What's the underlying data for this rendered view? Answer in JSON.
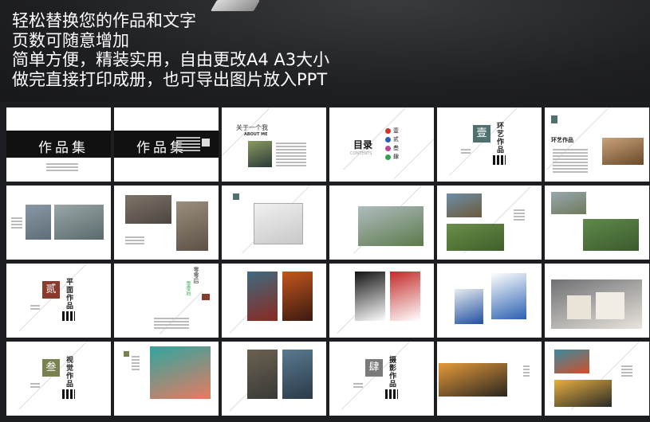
{
  "headline": [
    "轻松替换您的作品和文字",
    "页数可随意增加",
    "简单方便，精装实用，自由更改A4 A3大小",
    "做完直接打印成册，也可导出图片放入PPT"
  ],
  "pages": [
    {
      "kind": "cover",
      "title": "作品集"
    },
    {
      "kind": "cover2",
      "title": "作品集"
    },
    {
      "kind": "about",
      "title": "关于一个我",
      "subtitle": "ABOUT ME"
    },
    {
      "kind": "toc",
      "title": "目录",
      "subtitle": "CONTENTS",
      "items": [
        {
          "label": "壹",
          "color": "#d8322c"
        },
        {
          "label": "贰",
          "color": "#2a5fb8"
        },
        {
          "label": "叁",
          "color": "#b8479a"
        },
        {
          "label": "肆",
          "color": "#2ea54a"
        }
      ]
    },
    {
      "kind": "section",
      "num": "壹",
      "title": "环艺作品",
      "color": "#4f7270"
    },
    {
      "kind": "textimg",
      "title": "环艺作品",
      "badge_color": "#4f7270",
      "images": [
        "#c9a27a"
      ]
    },
    {
      "kind": "images",
      "images": [
        [
          "#8a98a6",
          "#5f6d78"
        ],
        [
          "#9aa6a8",
          "#5a6a6c"
        ]
      ],
      "layout": "two-right"
    },
    {
      "kind": "images",
      "images": [
        [
          "#7d7469",
          "#4d463e"
        ],
        [
          "#9b8e7d",
          "#5c5146"
        ]
      ],
      "layout": "two-left"
    },
    {
      "kind": "images",
      "images": [
        [
          "#f0f0f0",
          "#c8c8c8"
        ]
      ],
      "layout": "plan"
    },
    {
      "kind": "images",
      "images": [
        [
          "#b0bcc0",
          "#5c7a4a"
        ]
      ],
      "layout": "one"
    },
    {
      "kind": "images",
      "images": [
        [
          "#6b8ea8",
          "#6d5a3a"
        ],
        [
          "#6a8f4a",
          "#3f5f2a"
        ]
      ],
      "layout": "stack"
    },
    {
      "kind": "images",
      "images": [
        [
          "#98a8b0",
          "#6e7a5a"
        ],
        [
          "#5f8a4a",
          "#3c5a2e"
        ]
      ],
      "layout": "stack2"
    },
    {
      "kind": "section",
      "num": "贰",
      "title": "平面作品",
      "color": "#8a3b2e"
    },
    {
      "kind": "text",
      "title": "零零后",
      "color": "#3aa84a"
    },
    {
      "kind": "images",
      "images": [
        [
          "#3e6a80",
          "#8a2a20"
        ],
        [
          "#c4561e",
          "#3a1a10"
        ]
      ],
      "layout": "posters"
    },
    {
      "kind": "images",
      "images": [
        [
          "#111111",
          "#ffffff"
        ],
        [
          "#c42a2a",
          "#ffffff"
        ]
      ],
      "layout": "posters"
    },
    {
      "kind": "images",
      "images": [
        [
          "#e8ecef",
          "#1f4fa0"
        ],
        [
          "#ffffff",
          "#2a60b0"
        ]
      ],
      "layout": "brochure"
    },
    {
      "kind": "images",
      "images": [
        [
          "#6f7074",
          "#e8e4dc"
        ]
      ],
      "layout": "boxes"
    },
    {
      "kind": "section",
      "num": "叁",
      "title": "视觉作品",
      "color": "#7a8050"
    },
    {
      "kind": "images",
      "images": [
        [
          "#2fa6a0",
          "#e87a60"
        ]
      ],
      "layout": "horse"
    },
    {
      "kind": "images",
      "images": [
        [
          "#6a6050",
          "#3a3a38"
        ],
        [
          "#5a7a90",
          "#2a3a48"
        ]
      ],
      "layout": "posters"
    },
    {
      "kind": "section",
      "num": "肆",
      "title": "摄影作品",
      "color": "#7a7a7a"
    },
    {
      "kind": "images",
      "images": [
        [
          "#e59a3a",
          "#2a2620"
        ]
      ],
      "layout": "wide"
    },
    {
      "kind": "images",
      "images": [
        [
          "#3a8aa0",
          "#d0502a"
        ],
        [
          "#e8b040",
          "#2a2a28"
        ]
      ],
      "layout": "stack"
    }
  ]
}
